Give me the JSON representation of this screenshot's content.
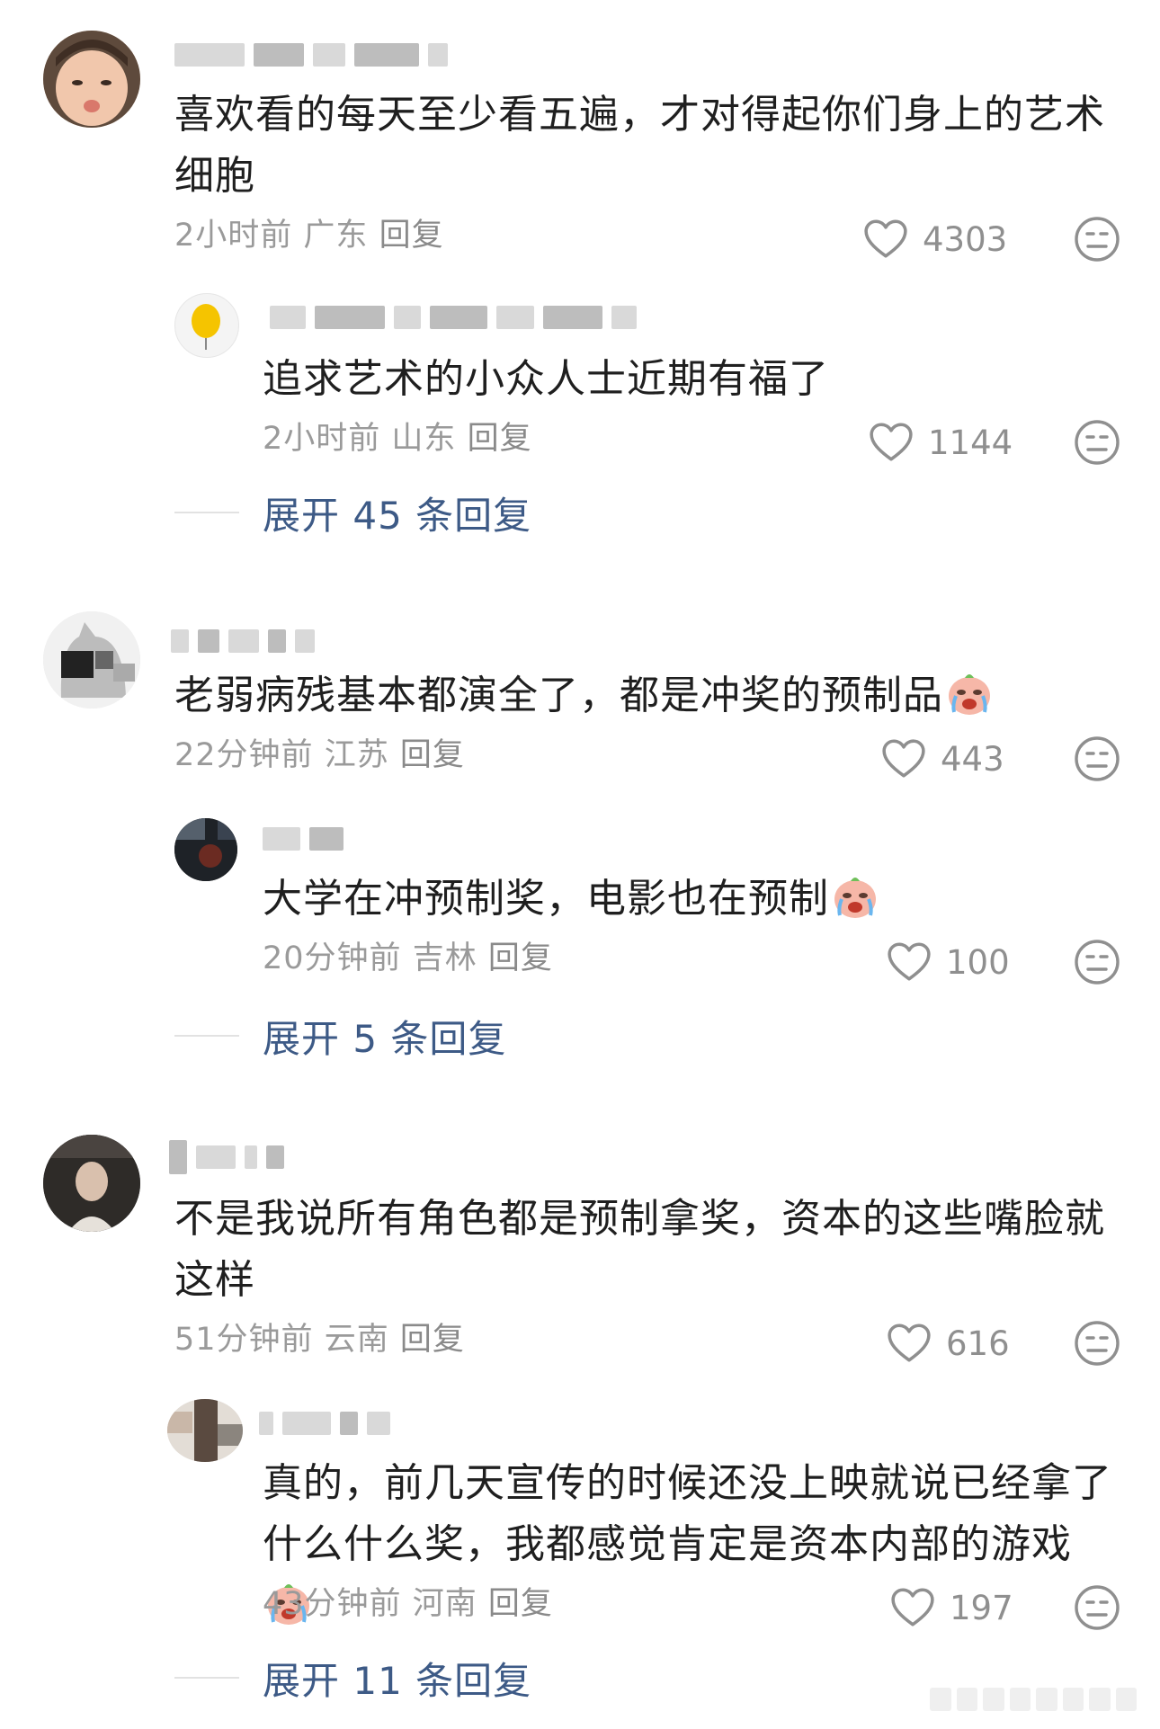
{
  "comments": [
    {
      "text": "喜欢看的每天至少看五遍，才对得起你们身上的艺术细胞",
      "time": "2小时前",
      "location": "广东",
      "reply_label": "回复",
      "likes": "4303",
      "replies": [
        {
          "text": "追求艺术的小众人士近期有福了",
          "time": "2小时前",
          "location": "山东",
          "reply_label": "回复",
          "likes": "1144"
        }
      ],
      "expand_label": "展开 45 条回复"
    },
    {
      "text": "老弱病残基本都演全了，都是冲奖的预制品",
      "emoji": "crying-face-emoji",
      "time": "22分钟前",
      "location": "江苏",
      "reply_label": "回复",
      "likes": "443",
      "replies": [
        {
          "text": "大学在冲预制奖，电影也在预制",
          "emoji": "tearful-laugh-emoji",
          "time": "20分钟前",
          "location": "吉林",
          "reply_label": "回复",
          "likes": "100"
        }
      ],
      "expand_label": "展开 5 条回复"
    },
    {
      "text": "不是我说所有角色都是预制拿奖，资本的这些嘴脸就这样",
      "time": "51分钟前",
      "location": "云南",
      "reply_label": "回复",
      "likes": "616",
      "replies": [
        {
          "text": "真的，前几天宣传的时候还没上映就说已经拿了什么什么奖，我都感觉肯定是资本内部的游戏",
          "emoji": "crying-face-emoji",
          "time": "43分钟前",
          "location": "河南",
          "reply_label": "回复",
          "likes": "197"
        }
      ],
      "expand_label": "展开 11 条回复"
    }
  ],
  "icons": {
    "like": "heart-outline-icon",
    "dislike": "neutral-face-icon"
  },
  "colors": {
    "text": "#1f1f1f",
    "meta": "#9a9a9a",
    "expand_link": "#3d5a86",
    "icon": "#8f8f8f"
  }
}
